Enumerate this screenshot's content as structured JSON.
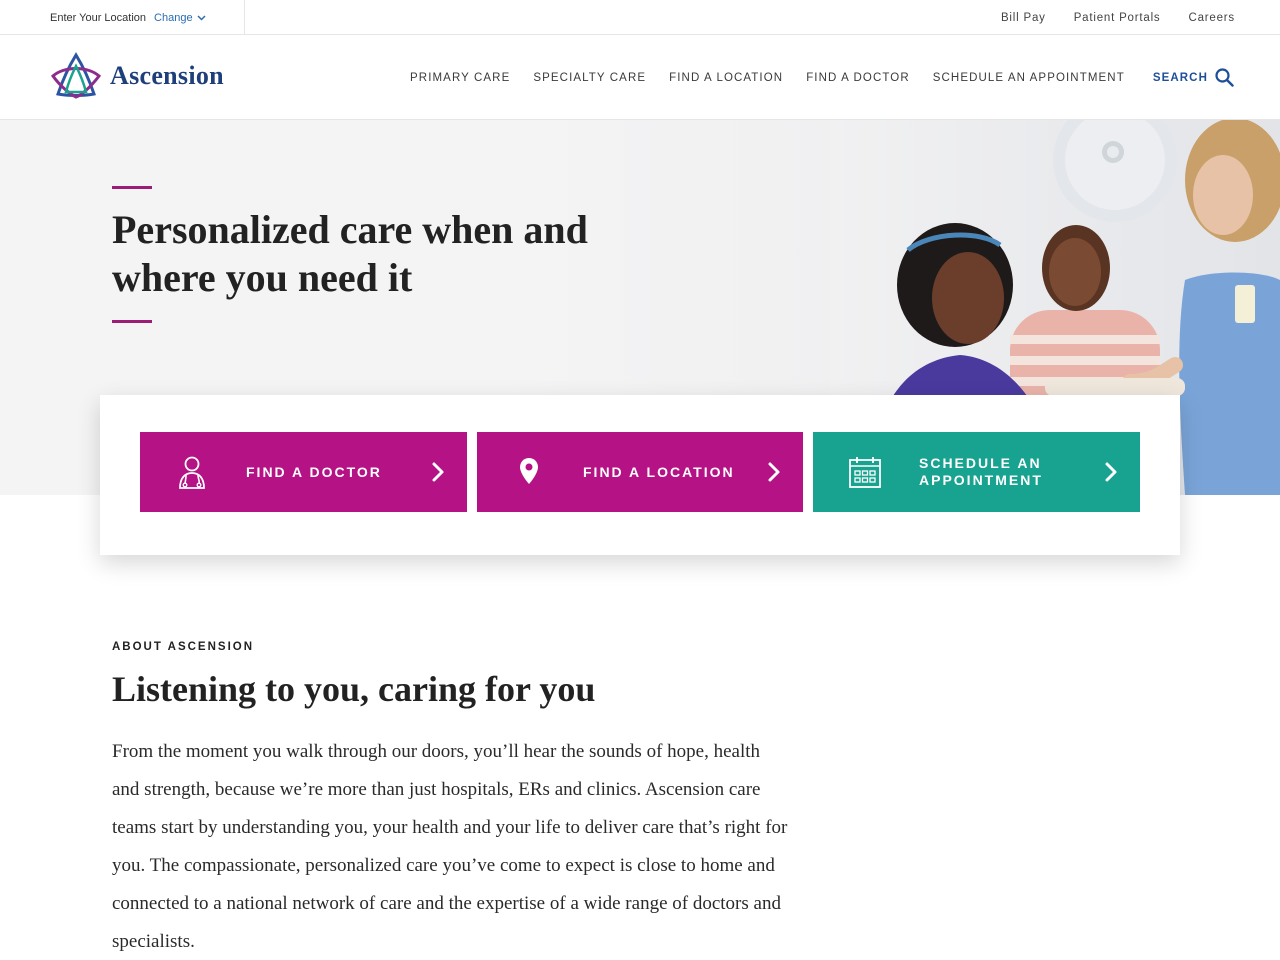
{
  "utility": {
    "location_label": "Enter Your Location",
    "change_label": "Change",
    "links": [
      "Bill Pay",
      "Patient Portals",
      "Careers"
    ]
  },
  "brand": {
    "name": "Ascension",
    "primary_color": "#1e3f7a",
    "accent_magenta": "#b51286",
    "accent_teal": "#17a38f"
  },
  "nav": {
    "items": [
      "PRIMARY CARE",
      "SPECIALTY CARE",
      "FIND A LOCATION",
      "FIND A DOCTOR",
      "SCHEDULE AN APPOINTMENT"
    ],
    "search_label": "SEARCH"
  },
  "hero": {
    "title_line1": "Personalized care when and",
    "title_line2": "where you need it"
  },
  "ctas": {
    "doctor": {
      "label": "FIND A DOCTOR",
      "icon": "doctor-icon"
    },
    "location": {
      "label": "FIND A LOCATION",
      "icon": "map-pin-icon"
    },
    "appointment": {
      "label_line1": "SCHEDULE AN",
      "label_line2": "APPOINTMENT",
      "icon": "calendar-icon"
    }
  },
  "about": {
    "eyebrow": "ABOUT ASCENSION",
    "title": "Listening to you, caring for you",
    "body": "From the moment you walk through our doors, you’ll hear the sounds of hope, health and strength, because we’re more than just hospitals, ERs and clinics. Ascension care teams start by understanding you, your health and your life to deliver care that’s right for you. The compassionate, personalized care you’ve come to expect is close to home and connected to a national network of care and the expertise of a wide range of doctors and specialists."
  }
}
